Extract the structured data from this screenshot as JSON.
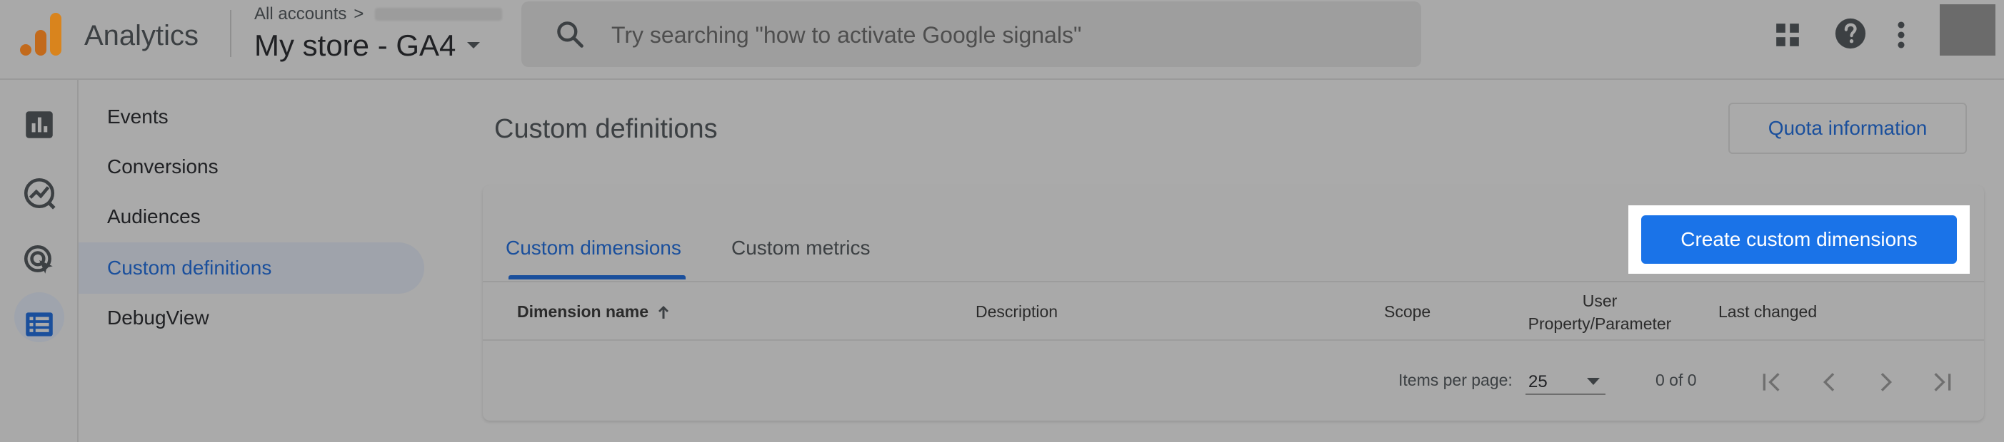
{
  "header": {
    "app_name": "Analytics",
    "breadcrumb_root": "All accounts",
    "breadcrumb_separator": ">",
    "property_name": "My store - GA4",
    "search_placeholder": "Try searching \"how to activate Google signals\"",
    "icons": [
      "analytics-logo-icon",
      "chevron-down-icon",
      "search-icon",
      "apps-grid-icon",
      "help-icon",
      "more-vert-icon"
    ]
  },
  "rail": {
    "icons": [
      "reports-icon",
      "explore-icon",
      "advertising-icon",
      "configure-icon"
    ],
    "active": "configure-icon"
  },
  "sidebar": {
    "items": [
      {
        "label": "Events"
      },
      {
        "label": "Conversions"
      },
      {
        "label": "Audiences"
      },
      {
        "label": "Custom definitions",
        "active": true
      },
      {
        "label": "DebugView"
      }
    ]
  },
  "main": {
    "title": "Custom definitions",
    "quota_button": "Quota information",
    "tabs": [
      {
        "label": "Custom dimensions",
        "active": true
      },
      {
        "label": "Custom metrics"
      }
    ],
    "create_button": "Create custom dimensions",
    "table": {
      "columns": [
        "Dimension name",
        "Description",
        "Scope",
        "User Property/Parameter",
        "Last changed"
      ],
      "rows": []
    },
    "pagination": {
      "items_per_page_label": "Items per page:",
      "items_per_page_value": "25",
      "range": "0 of 0"
    }
  },
  "colors": {
    "accent": "#1a73e8",
    "link": "#1a4f9c",
    "overlay_gray": "#aaaaaa"
  }
}
